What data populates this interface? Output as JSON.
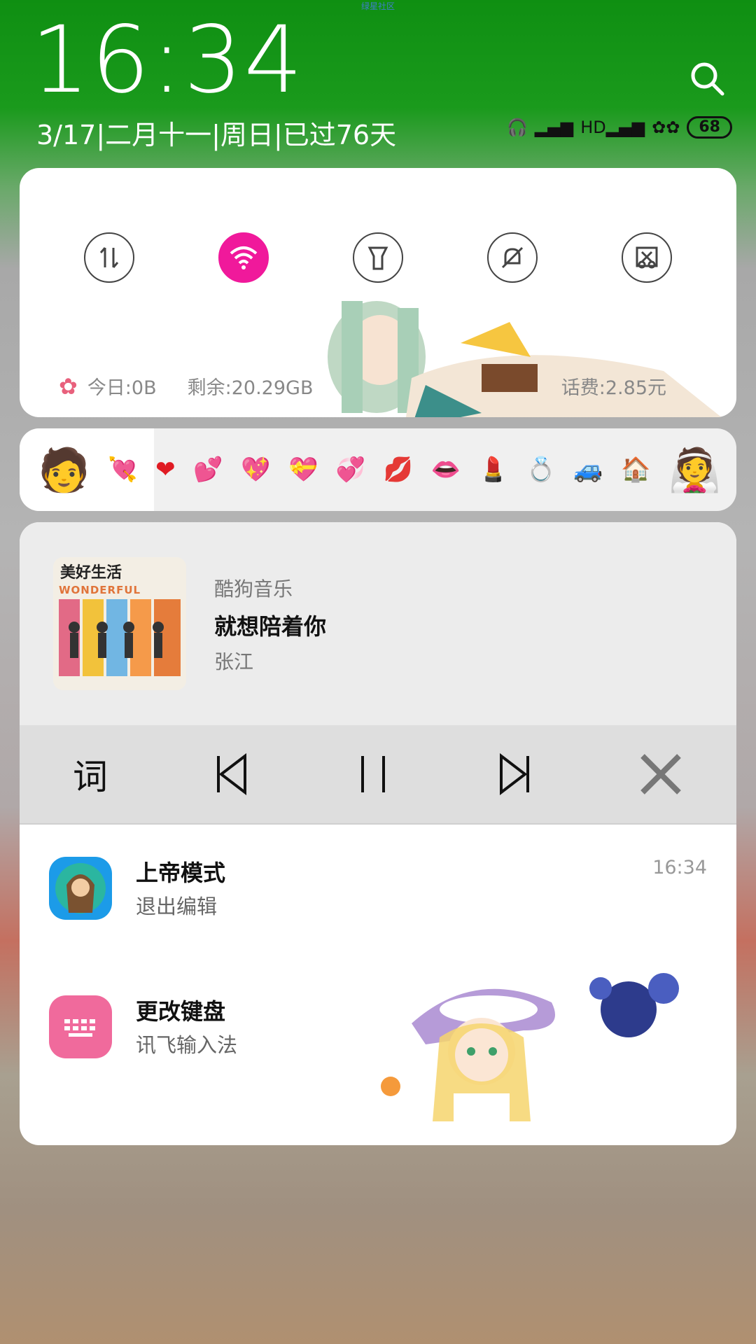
{
  "watermark": "绿星社区",
  "lock": {
    "time": "16:34",
    "date": "3/17|二月十一|周日|已过76天",
    "battery": "68"
  },
  "quick_settings": {
    "tiles": [
      {
        "name": "data-toggle-icon",
        "on": false
      },
      {
        "name": "wifi-icon",
        "on": true
      },
      {
        "name": "flashlight-icon",
        "on": false
      },
      {
        "name": "mute-icon",
        "on": false
      },
      {
        "name": "screenshot-icon",
        "on": false
      }
    ],
    "today_usage": "今日:0B",
    "remaining": "剩余:20.29GB",
    "fee": "话费:2.85元"
  },
  "emoji_bar": {
    "items": [
      "💘",
      "❤",
      "💕",
      "💖",
      "💝",
      "💞",
      "💋",
      "👄",
      "💄",
      "💍",
      "🚙",
      "🏠"
    ]
  },
  "music": {
    "app": "酷狗音乐",
    "song": "就想陪着你",
    "artist": "张江",
    "lyric_button": "词",
    "album_title": "美好生活",
    "album_word": "WONDERFUL"
  },
  "notifications": [
    {
      "title": "上帝模式",
      "subtitle": "退出编辑",
      "time": "16:34",
      "icon_color": "#1c9be8"
    },
    {
      "title": "更改键盘",
      "subtitle": "讯飞输入法",
      "time": "",
      "icon_color": "#f06a9c"
    }
  ],
  "colors": {
    "accent": "#f0199b"
  }
}
